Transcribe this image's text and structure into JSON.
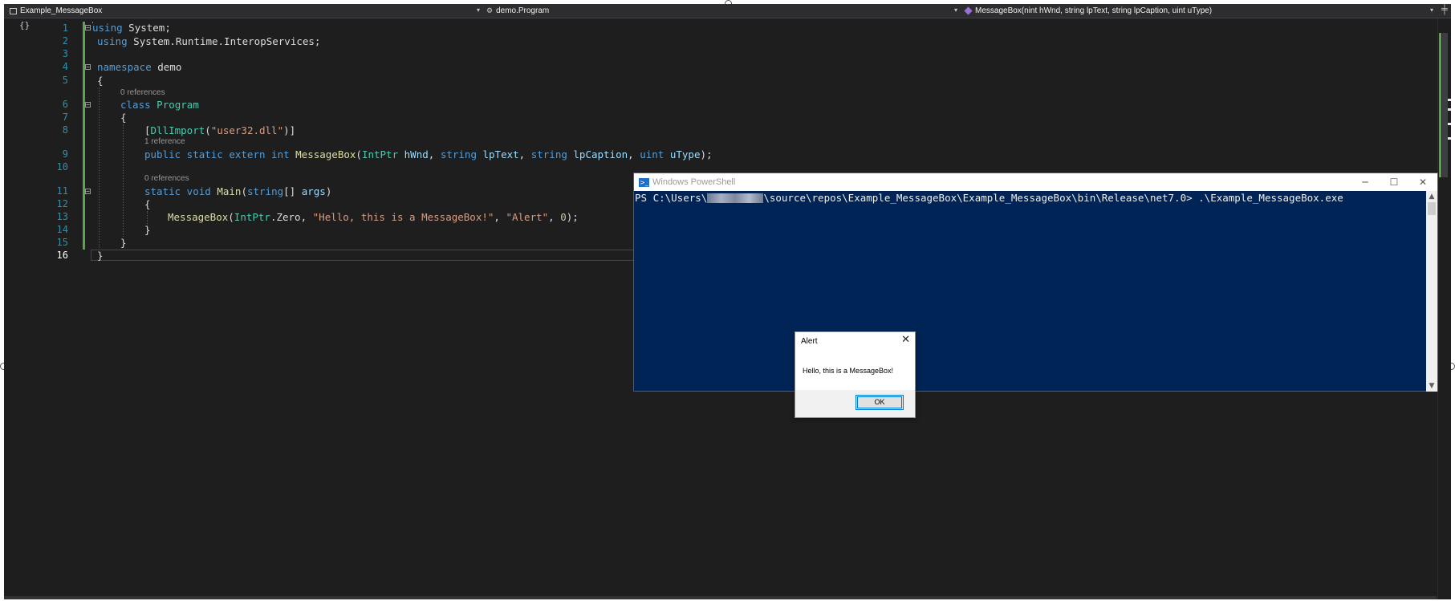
{
  "nav": {
    "project": "Example_MessageBox",
    "class_path": "demo.Program",
    "member": "MessageBox(nint hWnd, string lpText, string lpCaption, uint uType)"
  },
  "editor": {
    "line_numbers": [
      "1",
      "2",
      "3",
      "4",
      "5",
      "6",
      "7",
      "8",
      "9",
      "10",
      "11",
      "12",
      "13",
      "14",
      "15",
      "16"
    ],
    "current_line": "16",
    "lens": {
      "class_refs": "0 references",
      "messagebox_refs": "1 reference",
      "main_refs": "0 references"
    },
    "code": {
      "l1_kw": "using",
      "l1_rest": " System;",
      "l2_kw": "using",
      "l2_rest": " System.Runtime.InteropServices;",
      "l4_kw": "namespace",
      "l4_rest": " demo",
      "l5": "{",
      "l6_kw": "class",
      "l6_type": "Program",
      "l7": "{",
      "l8_open": "[",
      "l8_attr": "DllImport",
      "l8_paren": "(",
      "l8_str": "\"user32.dll\"",
      "l8_close": ")]",
      "l9_mods": "public static extern int",
      "l9_fn": "MessageBox",
      "l9_p1type": "IntPtr",
      "l9_p1": "hWnd",
      "l9_p2type": "string",
      "l9_p2": "lpText",
      "l9_p3type": "string",
      "l9_p3": "lpCaption",
      "l9_p4type": "uint",
      "l9_p4": "uType",
      "l11_mods": "static void",
      "l11_fn": "Main",
      "l11_ptype": "string",
      "l11_brackets": "[]",
      "l11_param": "args",
      "l12": "{",
      "l13_fn": "MessageBox",
      "l13_type": "IntPtr",
      "l13_member": ".Zero, ",
      "l13_str1": "\"Hello, this is a MessageBox!\"",
      "l13_str2": "\"Alert\"",
      "l13_num": "0",
      "l13_end": ");",
      "l14": "}",
      "l15": "}",
      "l16": "}"
    }
  },
  "powershell": {
    "title": "Windows PowerShell",
    "prompt_start": "PS C:\\Users\\",
    "prompt_rest": "\\source\\repos\\Example_MessageBox\\Example_MessageBox\\bin\\Release\\net7.0> .\\Example_MessageBox.exe",
    "minimize": "─",
    "maximize": "☐",
    "close": "✕"
  },
  "messagebox": {
    "title": "Alert",
    "text": "Hello, this is a MessageBox!",
    "ok_label": "OK",
    "close": "✕"
  },
  "colors": {
    "editor_bg": "#1e1e1e",
    "keyword": "#569cd6",
    "type": "#4ec9b0",
    "function": "#dcdcaa",
    "string": "#d69d85",
    "powershell_bg": "#012456"
  }
}
